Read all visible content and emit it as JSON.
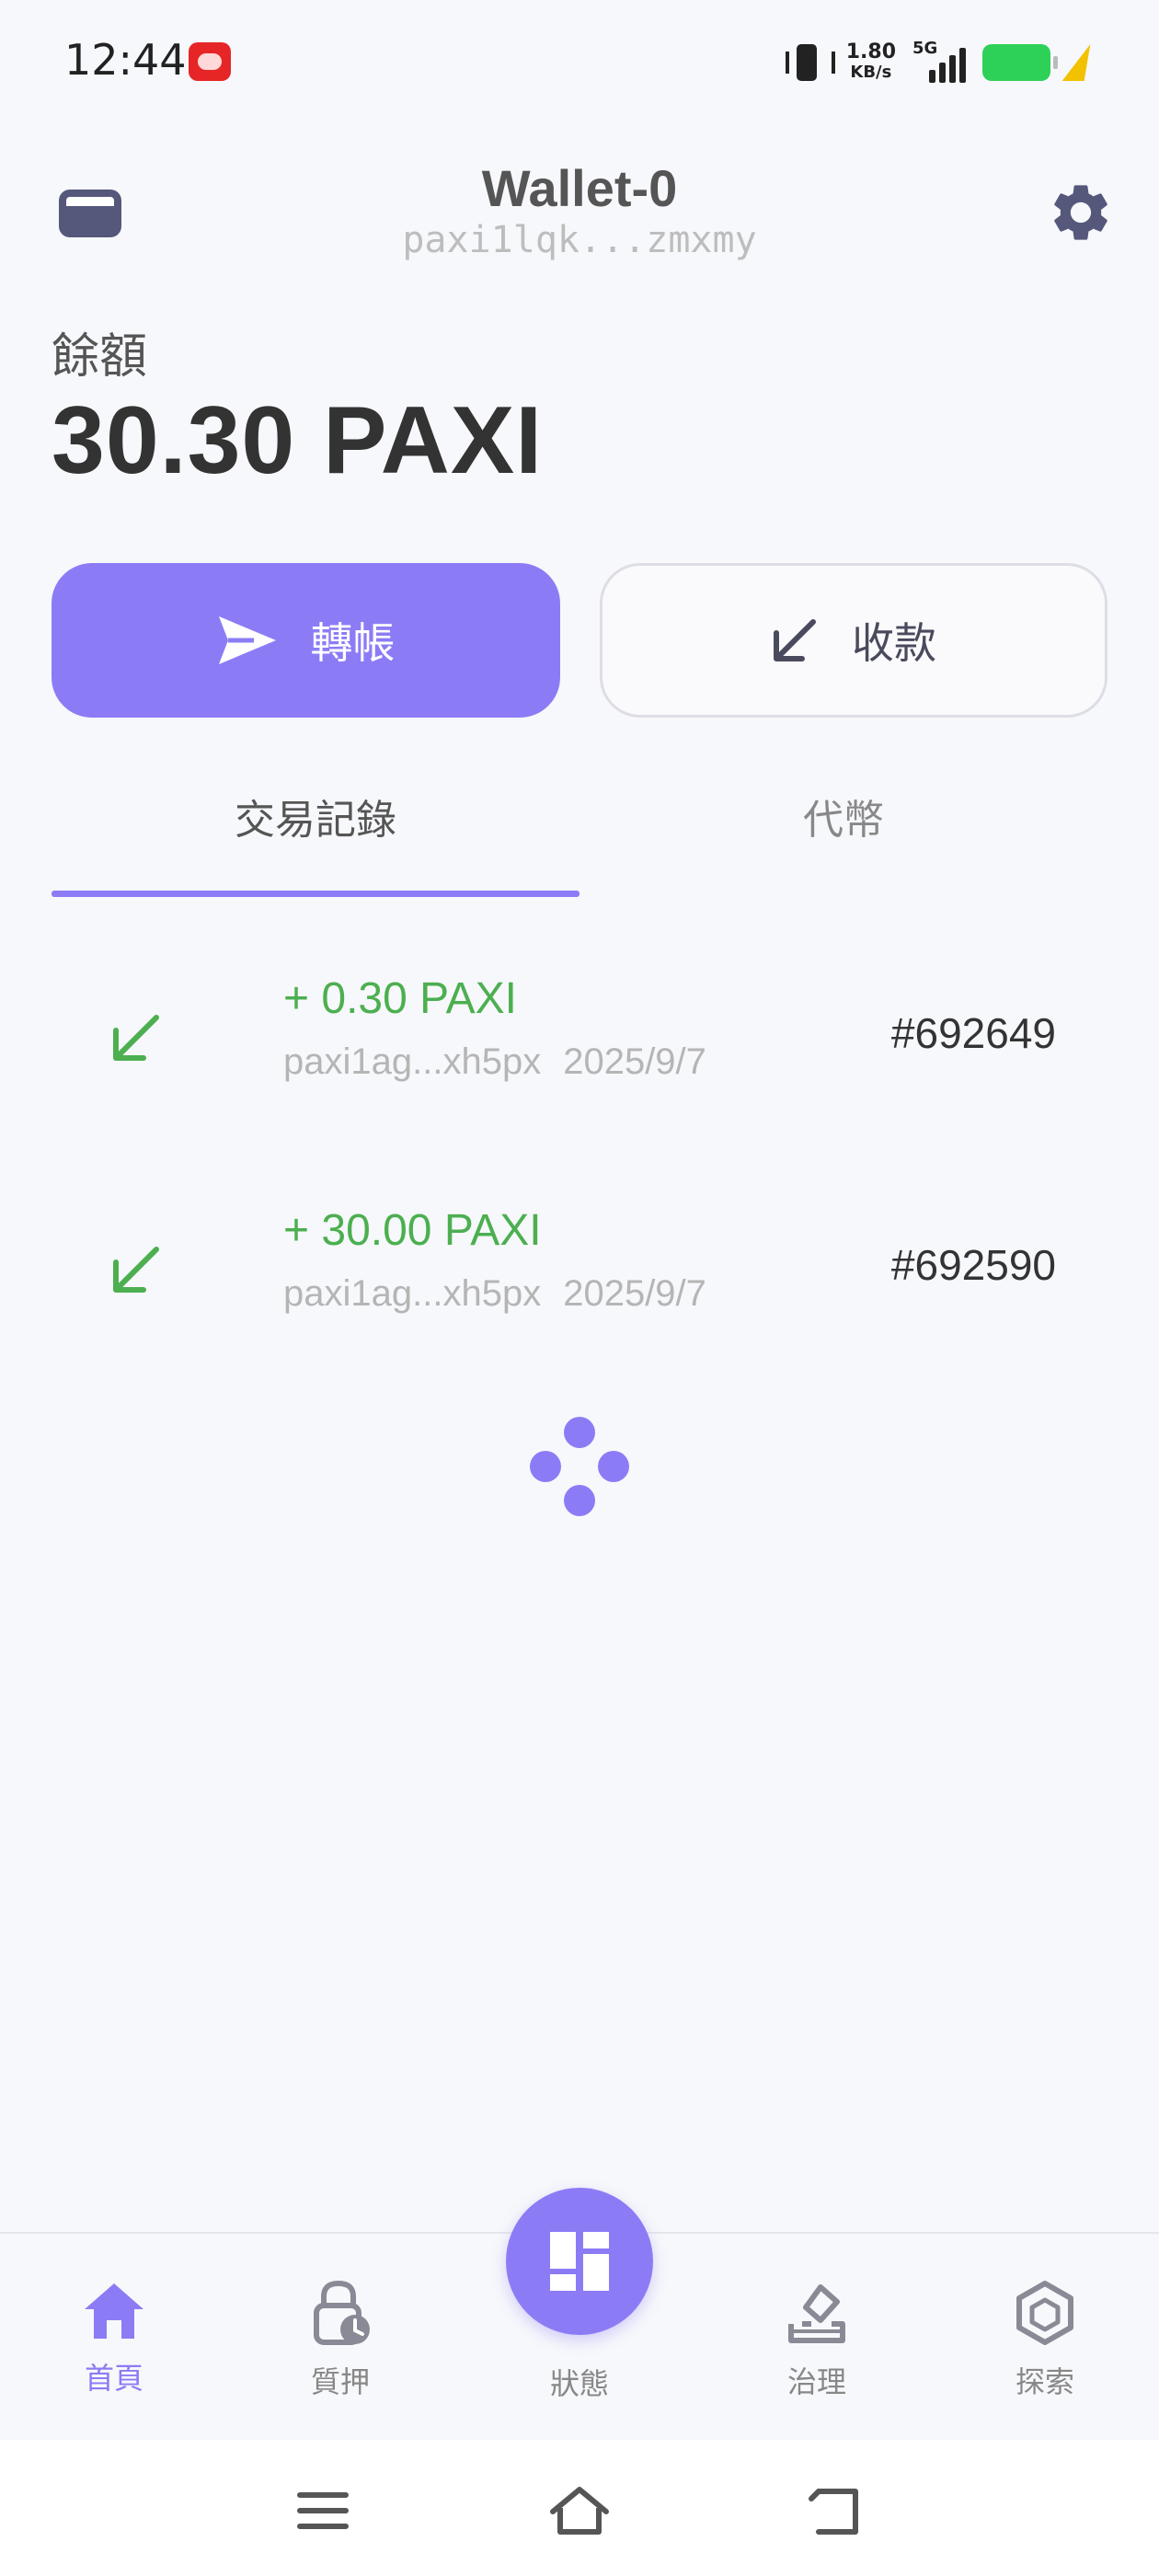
{
  "status_bar": {
    "time": "12:44",
    "net_speed_value": "1.80",
    "net_speed_unit": "KB/s",
    "network_type": "5G",
    "app_icon": "app-notification-icon",
    "icons": [
      "vibrate-icon",
      "signal-icon",
      "battery-icon",
      "charging-icon"
    ]
  },
  "header": {
    "title": "Wallet-0",
    "address": "paxi1lqk...zmxmy",
    "left_icon": "wallet-icon",
    "right_icon": "gear-icon"
  },
  "balance": {
    "label": "餘額",
    "value": "30.30 PAXI"
  },
  "actions": {
    "send_label": "轉帳",
    "receive_label": "收款"
  },
  "tabs": [
    {
      "label": "交易記錄",
      "active": true
    },
    {
      "label": "代幣",
      "active": false
    }
  ],
  "transactions": [
    {
      "amount": "+ 0.30 PAXI",
      "from": "paxi1ag...xh5px",
      "date": "2025/9/7",
      "id": "#692649"
    },
    {
      "amount": "+ 30.00 PAXI",
      "from": "paxi1ag...xh5px",
      "date": "2025/9/7",
      "id": "#692590"
    }
  ],
  "bottom_nav": [
    {
      "label": "首頁",
      "icon": "home-icon",
      "active": true
    },
    {
      "label": "質押",
      "icon": "lock-clock-icon",
      "active": false
    },
    {
      "label": "狀態",
      "icon": "dashboard-icon",
      "active": false
    },
    {
      "label": "治理",
      "icon": "vote-icon",
      "active": false
    },
    {
      "label": "探索",
      "icon": "cube-icon",
      "active": false
    }
  ],
  "colors": {
    "accent": "#8b7cf6",
    "positive": "#4caf50",
    "background": "#f7f8fb"
  }
}
